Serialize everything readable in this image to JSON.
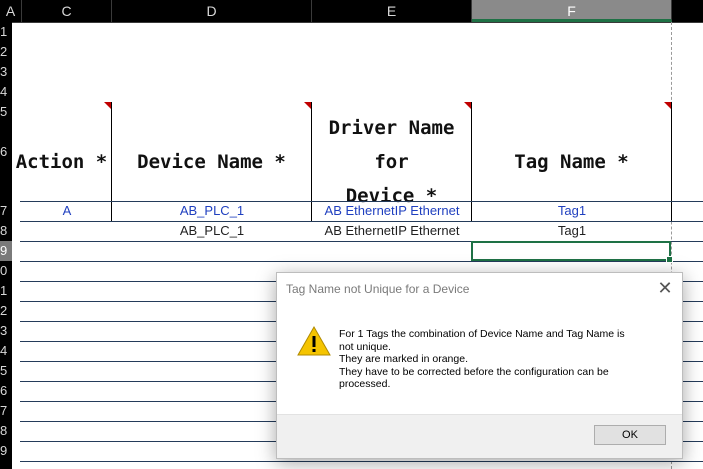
{
  "columns": [
    "A",
    "C",
    "D",
    "E",
    "F"
  ],
  "row_headers": [
    "1",
    "2",
    "3",
    "4",
    "5",
    "6",
    "7",
    "8",
    "9",
    "0",
    "1",
    "2",
    "3",
    "4",
    "5",
    "6",
    "7",
    "8",
    "9"
  ],
  "header_cells": {
    "action": "Action *",
    "device_name": "Device Name *",
    "driver_name_line1": "Driver Name for",
    "driver_name_line2": "Device *",
    "tag_name": "Tag Name *"
  },
  "rows": [
    {
      "action": "A",
      "device": "AB_PLC_1",
      "driver": "AB EthernetIP Ethernet",
      "tag": "Tag1"
    },
    {
      "action": "",
      "device": "AB_PLC_1",
      "driver": "AB EthernetIP Ethernet",
      "tag": "Tag1"
    }
  ],
  "dialog": {
    "title": "Tag Name not Unique for a Device",
    "icon": "warning-icon",
    "message_lines": [
      "For 1 Tags the combination of Device Name and Tag Name is",
      "not unique.",
      "They are marked in orange.",
      "They have to be corrected before the configuration can be",
      "processed."
    ],
    "ok_label": "OK"
  },
  "colors": {
    "selection_green": "#1e7145",
    "link_blue": "#1f3fbf",
    "comment_red": "#c00000",
    "warning_yellow": "#f5c400"
  }
}
